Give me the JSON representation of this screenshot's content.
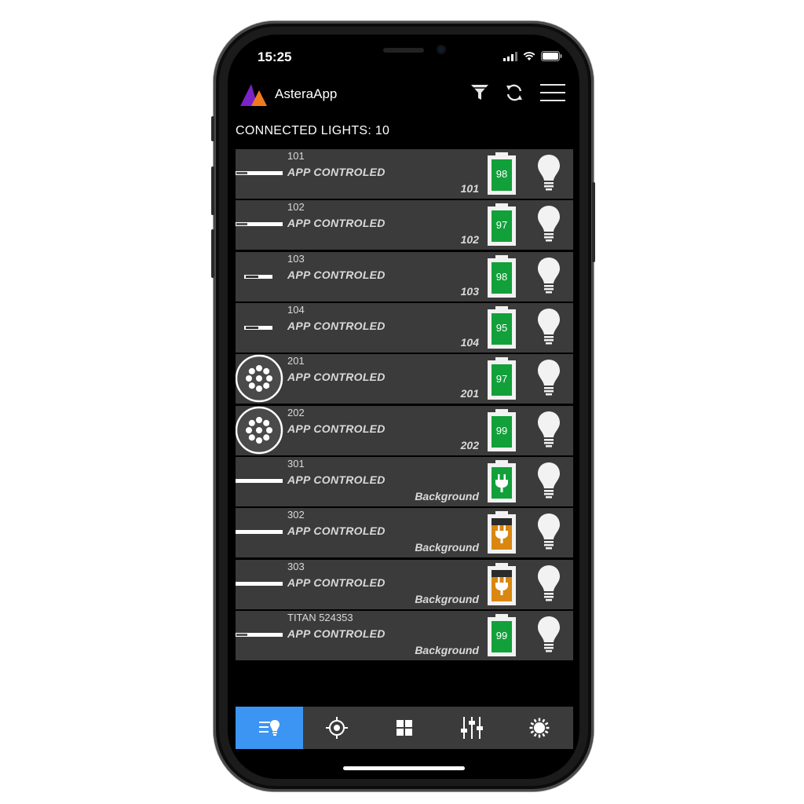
{
  "status_bar": {
    "time": "15:25"
  },
  "header": {
    "title": "AsteraApp",
    "icons": [
      "filter-icon",
      "refresh-icon",
      "menu-icon"
    ]
  },
  "connected_label": "CONNECTED LIGHTS: 10",
  "colors": {
    "battery_green": "#12a03a",
    "battery_orange": "#d98710",
    "active_tab": "#3d95f3",
    "row_bg": "#3b3b3b"
  },
  "lights": [
    {
      "name": "101",
      "mode": "APP CONTROLED",
      "tag": "101",
      "battery": "98",
      "power": "battery",
      "thumb": "tube"
    },
    {
      "name": "102",
      "mode": "APP CONTROLED",
      "tag": "102",
      "battery": "97",
      "power": "battery",
      "thumb": "tube"
    },
    {
      "name": "103",
      "mode": "APP CONTROLED",
      "tag": "103",
      "battery": "98",
      "power": "battery",
      "thumb": "short-tube"
    },
    {
      "name": "104",
      "mode": "APP CONTROLED",
      "tag": "104",
      "battery": "95",
      "power": "battery",
      "thumb": "short-tube"
    },
    {
      "name": "201",
      "mode": "APP CONTROLED",
      "tag": "201",
      "battery": "97",
      "power": "battery",
      "thumb": "round"
    },
    {
      "name": "202",
      "mode": "APP CONTROLED",
      "tag": "202",
      "battery": "99",
      "power": "battery",
      "thumb": "round"
    },
    {
      "name": "301",
      "mode": "APP CONTROLED",
      "tag": "Background",
      "battery": "",
      "power": "plug-green",
      "thumb": "long-tube"
    },
    {
      "name": "302",
      "mode": "APP CONTROLED",
      "tag": "Background",
      "battery": "",
      "power": "plug-orange",
      "thumb": "long-tube"
    },
    {
      "name": "303",
      "mode": "APP CONTROLED",
      "tag": "Background",
      "battery": "",
      "power": "plug-orange",
      "thumb": "long-tube"
    },
    {
      "name": "TITAN 524353",
      "mode": "APP CONTROLED",
      "tag": "Background",
      "battery": "99",
      "power": "battery",
      "thumb": "tube"
    }
  ],
  "bottom_nav": [
    {
      "icon": "light-list-icon",
      "active": true
    },
    {
      "icon": "target-icon",
      "active": false
    },
    {
      "icon": "grid-icon",
      "active": false
    },
    {
      "icon": "sliders-icon",
      "active": false
    },
    {
      "icon": "sun-icon",
      "active": false
    }
  ]
}
